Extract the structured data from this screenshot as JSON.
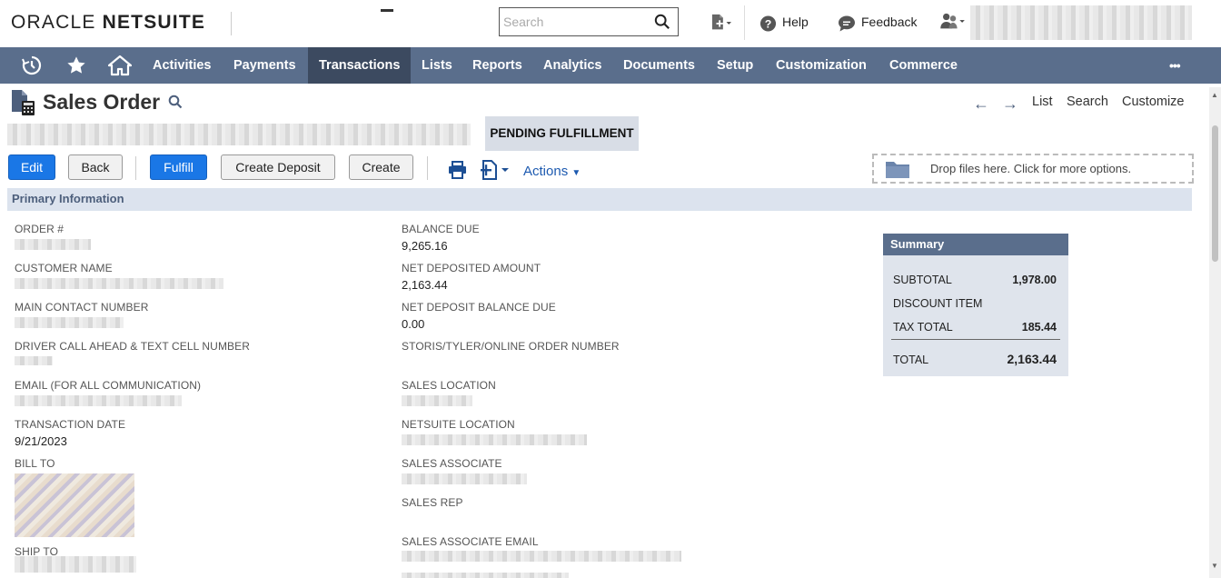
{
  "header": {
    "logo_oracle": "ORACLE",
    "logo_netsuite": "NETSUITE",
    "search_placeholder": "Search",
    "help_label": "Help",
    "feedback_label": "Feedback"
  },
  "nav": {
    "items": [
      {
        "label": "Activities"
      },
      {
        "label": "Payments"
      },
      {
        "label": "Transactions",
        "active": true
      },
      {
        "label": "Lists"
      },
      {
        "label": "Reports"
      },
      {
        "label": "Analytics"
      },
      {
        "label": "Documents"
      },
      {
        "label": "Setup"
      },
      {
        "label": "Customization"
      },
      {
        "label": "Commerce"
      }
    ],
    "more": "•••"
  },
  "page": {
    "title": "Sales Order",
    "status": "PENDING FULFILLMENT",
    "links": {
      "list": "List",
      "search": "Search",
      "customize": "Customize"
    }
  },
  "toolbar": {
    "edit": "Edit",
    "back": "Back",
    "fulfill": "Fulfill",
    "create_deposit": "Create Deposit",
    "create": "Create",
    "actions": "Actions",
    "dropzone": "Drop files here. Click for more options."
  },
  "section": {
    "primary": "Primary Information"
  },
  "fields_left": [
    {
      "label": "ORDER #",
      "value": ""
    },
    {
      "label": "CUSTOMER NAME",
      "value": ""
    },
    {
      "label": "MAIN CONTACT NUMBER",
      "value": ""
    },
    {
      "label": "DRIVER CALL AHEAD & TEXT CELL NUMBER",
      "value": ""
    },
    {
      "label": "EMAIL (FOR ALL COMMUNICATION)",
      "value": ""
    },
    {
      "label": "TRANSACTION DATE",
      "value": "9/21/2023"
    },
    {
      "label": "BILL TO",
      "value": ""
    },
    {
      "label": "SHIP TO",
      "value": ""
    }
  ],
  "fields_right": [
    {
      "label": "BALANCE DUE",
      "value": "9,265.16"
    },
    {
      "label": "NET DEPOSITED AMOUNT",
      "value": "2,163.44"
    },
    {
      "label": "NET DEPOSIT BALANCE DUE",
      "value": "0.00"
    },
    {
      "label": "STORIS/TYLER/ONLINE ORDER NUMBER",
      "value": ""
    },
    {
      "label": "SALES LOCATION",
      "value": ""
    },
    {
      "label": "NETSUITE LOCATION",
      "value": ""
    },
    {
      "label": "SALES ASSOCIATE",
      "value": ""
    },
    {
      "label": "SALES REP",
      "value": ""
    },
    {
      "label": "SALES ASSOCIATE EMAIL",
      "value": ""
    }
  ],
  "summary": {
    "title": "Summary",
    "subtotal_label": "SUBTOTAL",
    "subtotal": "1,978.00",
    "discount_label": "DISCOUNT ITEM",
    "tax_label": "TAX TOTAL",
    "tax": "185.44",
    "total_label": "TOTAL",
    "total": "2,163.44"
  },
  "colors": {
    "nav_bg": "#5a6e8c",
    "nav_active": "#3c4a60",
    "primary_button": "#1a77e6",
    "section_bg": "#dce3ee"
  }
}
